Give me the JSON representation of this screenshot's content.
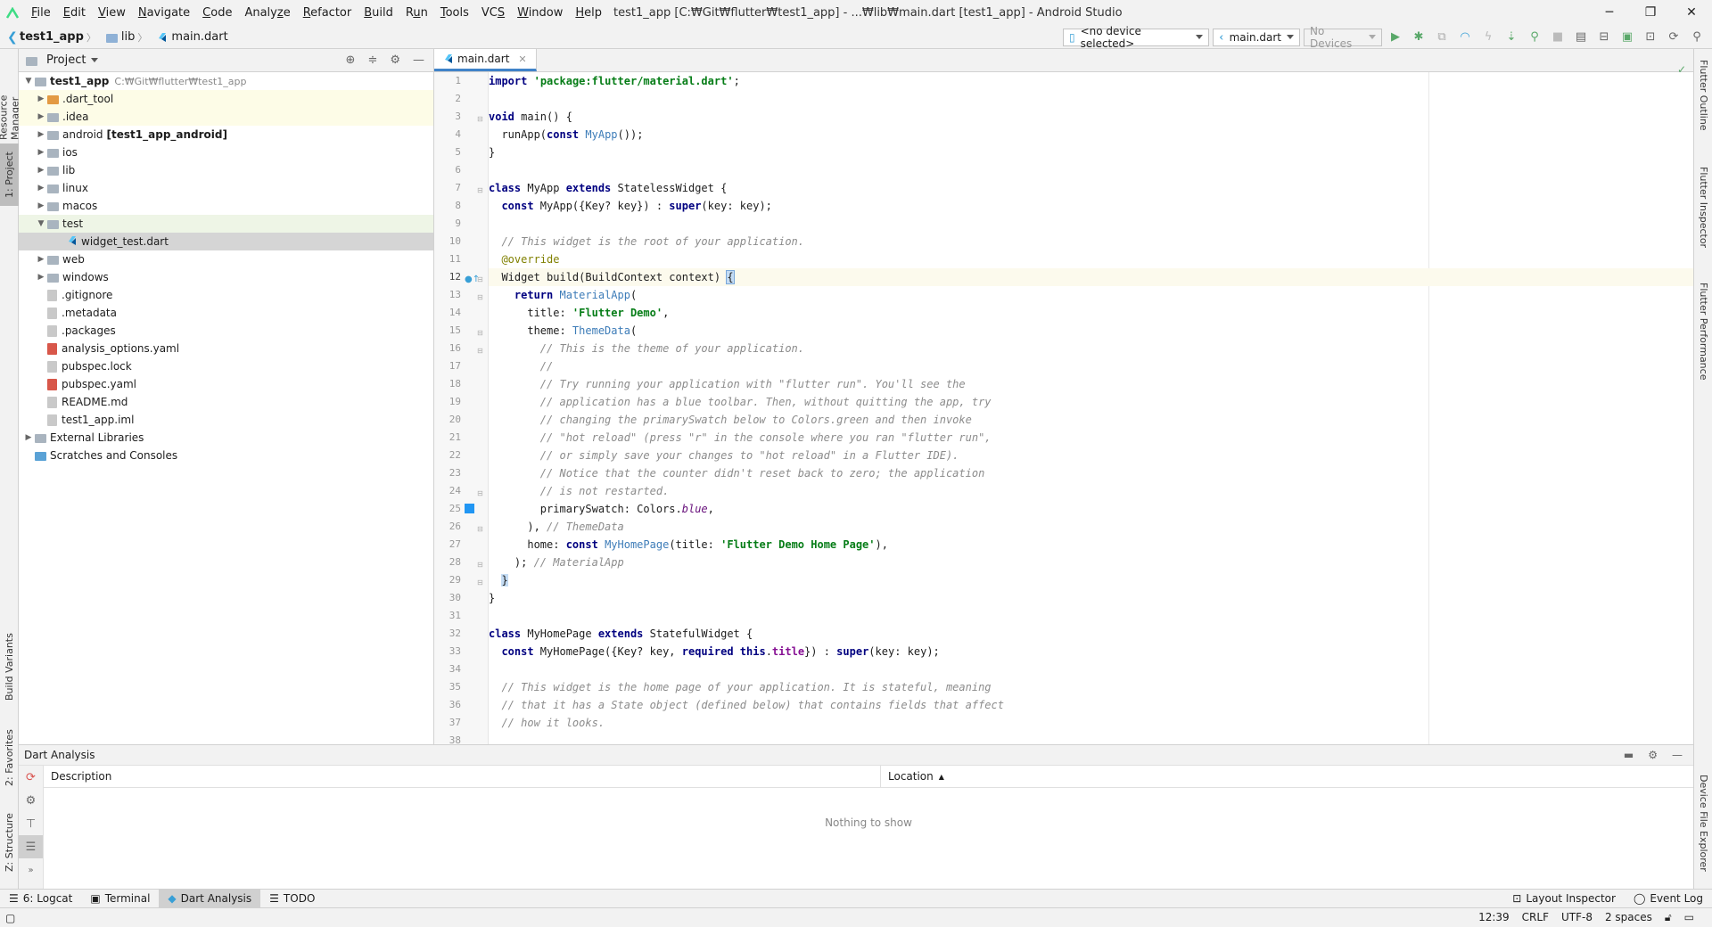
{
  "window": {
    "title": "test1_app [C:₩Git₩flutter₩test1_app] - ...₩lib₩main.dart [test1_app] - Android Studio",
    "min": "─",
    "max": "❐",
    "close": "✕"
  },
  "menu": [
    {
      "pre": "",
      "u": "F",
      "post": "ile"
    },
    {
      "pre": "",
      "u": "E",
      "post": "dit"
    },
    {
      "pre": "",
      "u": "V",
      "post": "iew"
    },
    {
      "pre": "",
      "u": "N",
      "post": "avigate"
    },
    {
      "pre": "",
      "u": "C",
      "post": "ode"
    },
    {
      "pre": "Analy",
      "u": "z",
      "post": "e"
    },
    {
      "pre": "",
      "u": "R",
      "post": "efactor"
    },
    {
      "pre": "",
      "u": "B",
      "post": "uild"
    },
    {
      "pre": "R",
      "u": "u",
      "post": "n"
    },
    {
      "pre": "",
      "u": "T",
      "post": "ools"
    },
    {
      "pre": "VC",
      "u": "S",
      "post": ""
    },
    {
      "pre": "",
      "u": "W",
      "post": "indow"
    },
    {
      "pre": "",
      "u": "H",
      "post": "elp"
    }
  ],
  "breadcrumb": [
    "test1_app",
    "lib",
    "main.dart"
  ],
  "toolbar": {
    "device": "<no device selected>",
    "config": "main.dart",
    "devices": "No Devices"
  },
  "left_tabs": {
    "resource_manager": "Resource Manager",
    "project": "1: Project",
    "build_variants": "Build Variants",
    "favorites": "2: Favorites",
    "structure": "Z: Structure"
  },
  "right_tabs": {
    "outline": "Flutter Outline",
    "inspector": "Flutter Inspector",
    "performance": "Flutter Performance",
    "device_explorer": "Device File Explorer"
  },
  "project": {
    "title": "Project",
    "root": {
      "name": "test1_app",
      "path": "C:₩Git₩flutter₩test1_app"
    },
    "items": [
      {
        "name": ".dart_tool",
        "icon": "orange"
      },
      {
        "name": ".idea",
        "icon": "gray"
      },
      {
        "name": "android",
        "suffix": "[test1_app_android]",
        "icon": "gray"
      },
      {
        "name": "ios",
        "icon": "gray"
      },
      {
        "name": "lib",
        "icon": "gray"
      },
      {
        "name": "linux",
        "icon": "gray"
      },
      {
        "name": "macos",
        "icon": "gray"
      },
      {
        "name": "test",
        "icon": "gray"
      },
      {
        "name": "widget_test.dart",
        "icon": "dart"
      },
      {
        "name": "web",
        "icon": "gray"
      },
      {
        "name": "windows",
        "icon": "gray"
      },
      {
        "name": ".gitignore",
        "icon": "file"
      },
      {
        "name": ".metadata",
        "icon": "file"
      },
      {
        "name": ".packages",
        "icon": "file"
      },
      {
        "name": "analysis_options.yaml",
        "icon": "yaml"
      },
      {
        "name": "pubspec.lock",
        "icon": "file"
      },
      {
        "name": "pubspec.yaml",
        "icon": "yaml"
      },
      {
        "name": "README.md",
        "icon": "file"
      },
      {
        "name": "test1_app.iml",
        "icon": "file"
      }
    ],
    "external": "External Libraries",
    "scratches": "Scratches and Consoles"
  },
  "editor": {
    "tab": "main.dart",
    "line_numbers": [
      "1",
      "2",
      "3",
      "4",
      "5",
      "6",
      "7",
      "8",
      "9",
      "10",
      "11",
      "12",
      "13",
      "14",
      "15",
      "16",
      "17",
      "18",
      "19",
      "20",
      "21",
      "22",
      "23",
      "24",
      "25",
      "26",
      "27",
      "28",
      "29",
      "30",
      "31",
      "32",
      "33",
      "34",
      "35",
      "36",
      "37",
      "38"
    ]
  },
  "dart_analysis": {
    "title": "Dart Analysis",
    "col_description": "Description",
    "col_location": "Location",
    "empty": "Nothing to show"
  },
  "bottom_tabs": {
    "logcat": "6: Logcat",
    "terminal": "Terminal",
    "dart_analysis": "Dart Analysis",
    "todo": "TODO",
    "layout_inspector": "Layout Inspector",
    "event_log": "Event Log"
  },
  "status": {
    "position": "12:39",
    "line_sep": "CRLF",
    "encoding": "UTF-8",
    "indent": "2 spaces"
  }
}
